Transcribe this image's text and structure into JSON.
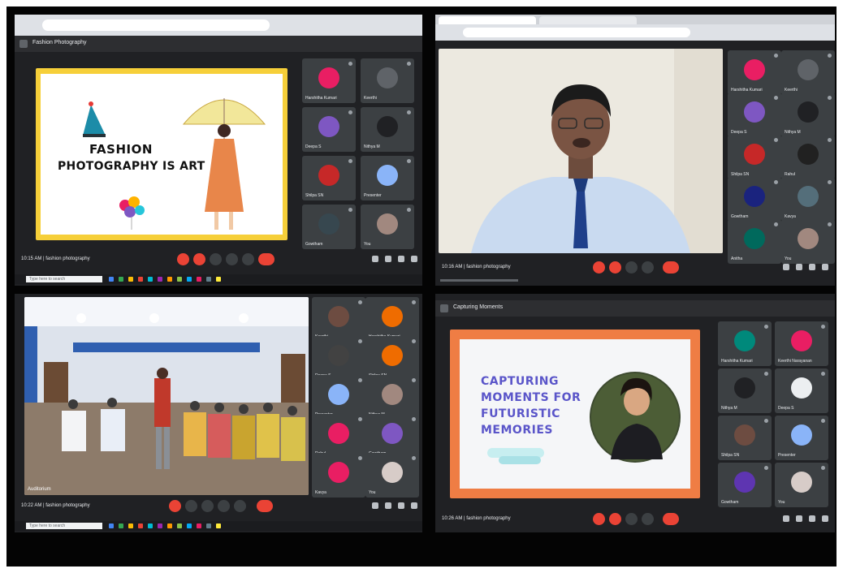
{
  "quadrant_1": {
    "meeting_title": "Fashion Photography",
    "slide_line_1": "FASHION",
    "slide_line_2": "PHOTOGRAPHY IS ART",
    "meeting_meta": "10:15 AM | fashion photography",
    "taskbar_search": "Type here to search",
    "participants": [
      {
        "name": "Harshitha Kumari",
        "color": "#e91e63"
      },
      {
        "name": "Keerthi",
        "color": "#5f6368"
      },
      {
        "name": "Deepa S",
        "color": "#7e57c2"
      },
      {
        "name": "Nithya M",
        "color": "#202124"
      },
      {
        "name": "Shilpa SN",
        "color": "#c62828"
      },
      {
        "name": "Presenter",
        "color": "#8ab4f8"
      },
      {
        "name": "Gowtham",
        "color": "#37474f"
      },
      {
        "name": "You",
        "color": "#a1887f"
      }
    ]
  },
  "quadrant_2": {
    "meeting_meta": "10:16 AM | fashion photography",
    "participants": [
      {
        "name": "Harshitha Kumari",
        "color": "#e91e63"
      },
      {
        "name": "Keerthi",
        "color": "#5f6368"
      },
      {
        "name": "Deepa S",
        "color": "#7e57c2"
      },
      {
        "name": "Nithya M",
        "color": "#202124"
      },
      {
        "name": "Shilpa SN",
        "color": "#c62828"
      },
      {
        "name": "Rahul",
        "color": "#212121"
      },
      {
        "name": "Gowtham",
        "color": "#1a237e"
      },
      {
        "name": "Kavya",
        "color": "#546e7a"
      },
      {
        "name": "Anitha",
        "color": "#00695c"
      },
      {
        "name": "You",
        "color": "#a1887f"
      }
    ]
  },
  "quadrant_3": {
    "meeting_meta": "10:22 AM | fashion photography",
    "pinned_name": "Auditorium",
    "taskbar_search": "Type here to search",
    "participants": [
      {
        "name": "Keerthi",
        "color": "#6d4c41"
      },
      {
        "name": "Harshitha Kumari",
        "color": "#ef6c00"
      },
      {
        "name": "Deepa S",
        "color": "#424242"
      },
      {
        "name": "Shilpa SN",
        "color": "#ef6c00"
      },
      {
        "name": "Presenter",
        "color": "#8ab4f8"
      },
      {
        "name": "Nithya M",
        "color": "#a1887f"
      },
      {
        "name": "Rahul",
        "color": "#e91e63"
      },
      {
        "name": "Gowtham",
        "color": "#7e57c2"
      },
      {
        "name": "Kavya",
        "color": "#e91e63"
      },
      {
        "name": "You",
        "color": "#d7ccc8"
      }
    ]
  },
  "quadrant_4": {
    "meeting_title": "Capturing Moments",
    "slide_lines": [
      "CAPTURING",
      "MOMENTS FOR",
      "FUTURISTIC",
      "MEMORIES"
    ],
    "meeting_meta": "10:26 AM | fashion photography",
    "participants": [
      {
        "name": "Harshitha Kumari",
        "color": "#00897b"
      },
      {
        "name": "Keerthi Narayanan",
        "color": "#e91e63"
      },
      {
        "name": "Nithya M",
        "color": "#202124"
      },
      {
        "name": "Deepa S",
        "color": "#eceff1"
      },
      {
        "name": "Shilpa SN",
        "color": "#6d4c41"
      },
      {
        "name": "Presenter",
        "color": "#8ab4f8"
      },
      {
        "name": "Gowtham",
        "color": "#5e35b1"
      },
      {
        "name": "You",
        "color": "#d7ccc8"
      }
    ]
  }
}
